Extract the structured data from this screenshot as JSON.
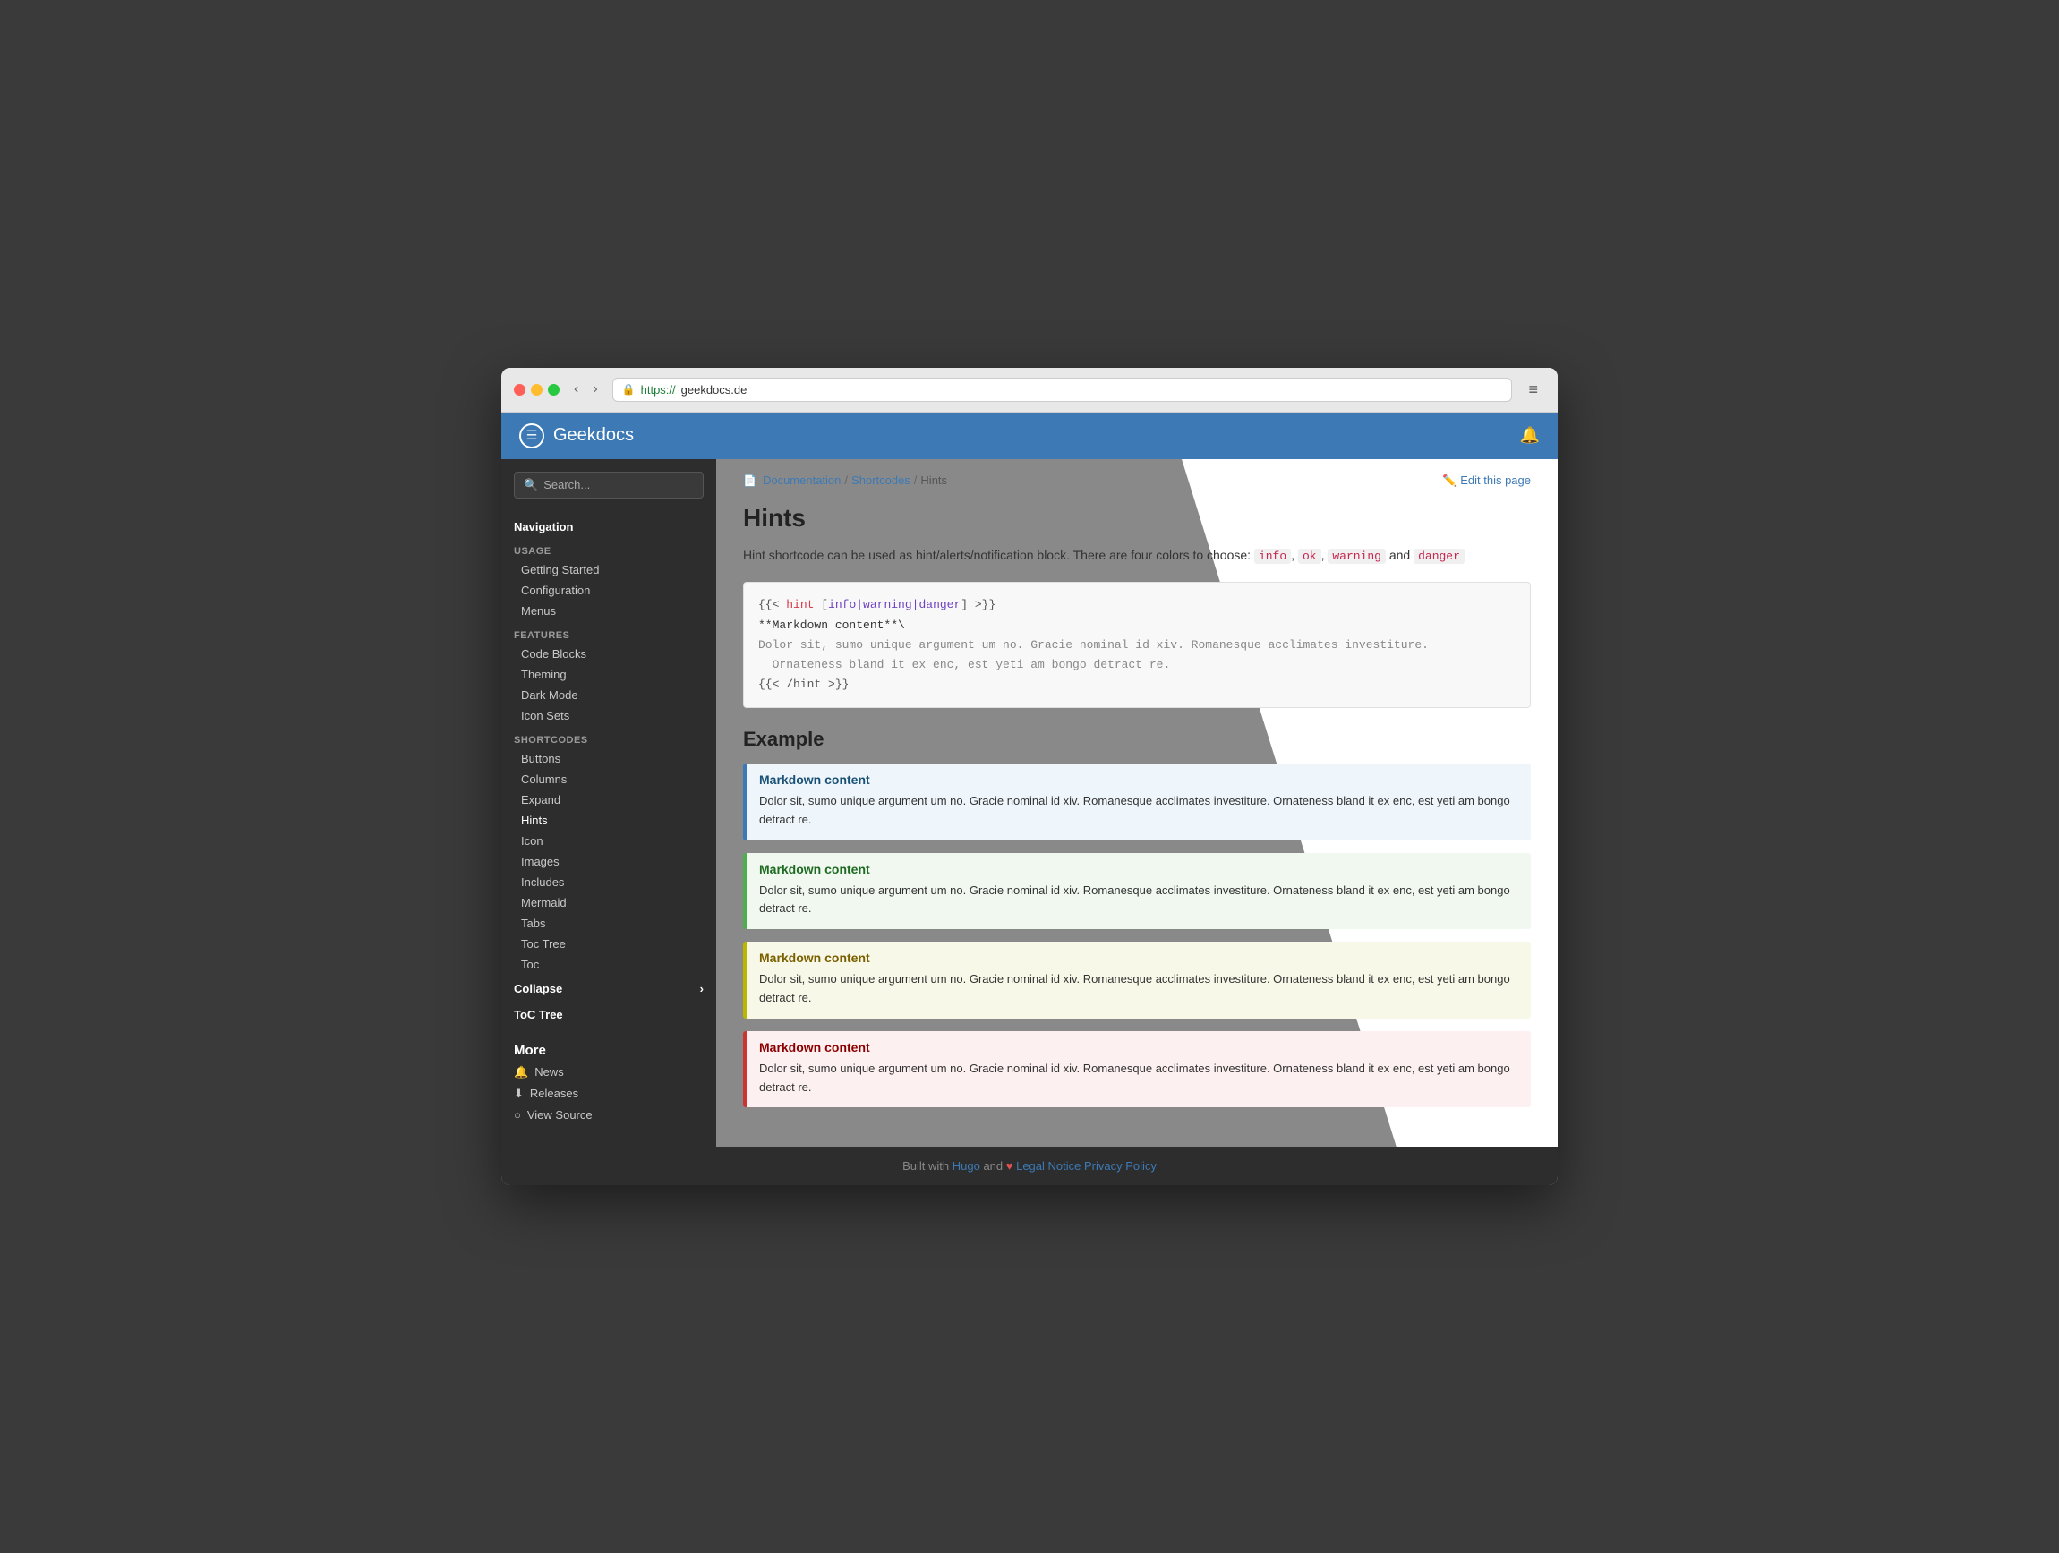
{
  "browser": {
    "url_https": "https://",
    "url_rest": "geekdocs.de",
    "back_label": "‹",
    "forward_label": "›",
    "menu_label": "≡"
  },
  "header": {
    "logo_text": "Geekdocs",
    "logo_icon": "☰",
    "settings_icon": "🔔"
  },
  "sidebar": {
    "search_placeholder": "Search...",
    "nav_title": "Navigation",
    "usage_label": "Usage",
    "usage_items": [
      "Getting Started",
      "Configuration",
      "Menus"
    ],
    "features_label": "Features",
    "features_items": [
      "Code Blocks",
      "Theming",
      "Dark Mode",
      "Icon Sets"
    ],
    "shortcodes_label": "Shortcodes",
    "shortcodes_items": [
      "Buttons",
      "Columns",
      "Expand",
      "Hints",
      "Icon",
      "Images",
      "Includes",
      "Mermaid",
      "Tabs",
      "Toc Tree",
      "Toc"
    ],
    "collapse_label": "Collapse",
    "toc_tree_label": "ToC Tree",
    "more_title": "More",
    "more_items": [
      {
        "icon": "🔔",
        "label": "News"
      },
      {
        "icon": "⬇",
        "label": "Releases"
      },
      {
        "icon": "○",
        "label": "View Source"
      }
    ]
  },
  "breadcrumb": {
    "doc_link": "Documentation",
    "shortcodes_link": "Shortcodes",
    "current": "Hints",
    "edit_label": "Edit this page",
    "doc_icon": "📄"
  },
  "page": {
    "title": "Hints",
    "intro": "Hint shortcode can be used as hint/alerts/notification block. There are four colors to choose:",
    "colors": [
      "info",
      "ok",
      "warning",
      "danger"
    ],
    "code_block": {
      "line1": "{{< hint [info|warning|danger] >}}",
      "line2": "**Markdown content**\\",
      "line3": "Dolor sit, sumo unique argument um no. Gracie nominal id xiv. Romanesque acclimates investiture.",
      "line4": "  Ornateness bland it ex enc, est yeti am bongo detract re.",
      "line5": "{{< /hint >}}"
    },
    "example_title": "Example",
    "hint_boxes": [
      {
        "type": "info",
        "header": "Markdown content",
        "body": "Dolor sit, sumo unique argument um no. Gracie nominal id xiv. Romanesque acclimates investiture. Ornateness bland it ex enc, est yeti am bongo detract re."
      },
      {
        "type": "ok",
        "header": "Markdown content",
        "body": "Dolor sit, sumo unique argument um no. Gracie nominal id xiv. Romanesque acclimates investiture. Ornateness bland it ex enc, est yeti am bongo detract re."
      },
      {
        "type": "warning",
        "header": "Markdown content",
        "body": "Dolor sit, sumo unique argument um no. Gracie nominal id xiv. Romanesque acclimates investiture. Ornateness bland it ex enc, est yeti am bongo detract re."
      },
      {
        "type": "danger",
        "header": "Markdown content",
        "body": "Dolor sit, sumo unique argument um no. Gracie nominal id xiv. Romanesque acclimates investiture. Ornateness bland it ex enc, est yeti am bongo detract re."
      }
    ]
  },
  "footer": {
    "built_with": "Built with",
    "hugo_label": "Hugo",
    "and_text": "and",
    "legal_label": "Legal Notice",
    "privacy_label": "Privacy Policy"
  }
}
